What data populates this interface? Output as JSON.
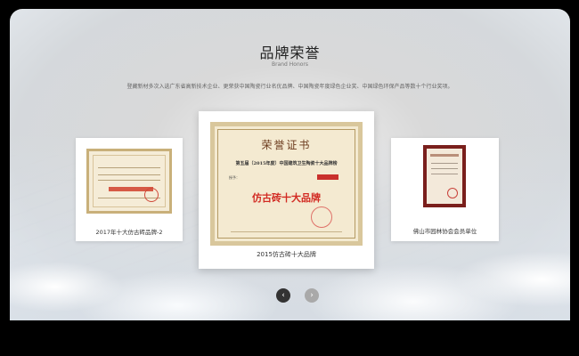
{
  "section": {
    "title": "品牌荣誉",
    "subtitle": "Brand Honors",
    "description": "登藏新材多次入选广东省高新技术企业、更荣获中国陶瓷行业名优品牌、中国陶瓷年度绿色企业奖、中国绿色环保产品等数十个行业奖项。"
  },
  "carousel": {
    "cards": [
      {
        "caption": "2017年十大仿古砖品牌-2"
      },
      {
        "caption": "2015仿古砖十大品牌",
        "certificate": {
          "heading": "荣誉证书",
          "line": "第五届（2015年度）中国建筑卫生陶瓷十大品牌榜",
          "award": "仿古砖十大品牌"
        }
      },
      {
        "caption": "佛山市园林协会会员单位"
      }
    ],
    "prev_icon": "‹",
    "next_icon": "›"
  },
  "icons": {
    "prev": "chevron-left-icon",
    "next": "chevron-right-icon"
  },
  "colors": {
    "accent_red": "#d22a22",
    "nav_active": "#333333",
    "nav_inactive": "#a9a9a9"
  }
}
